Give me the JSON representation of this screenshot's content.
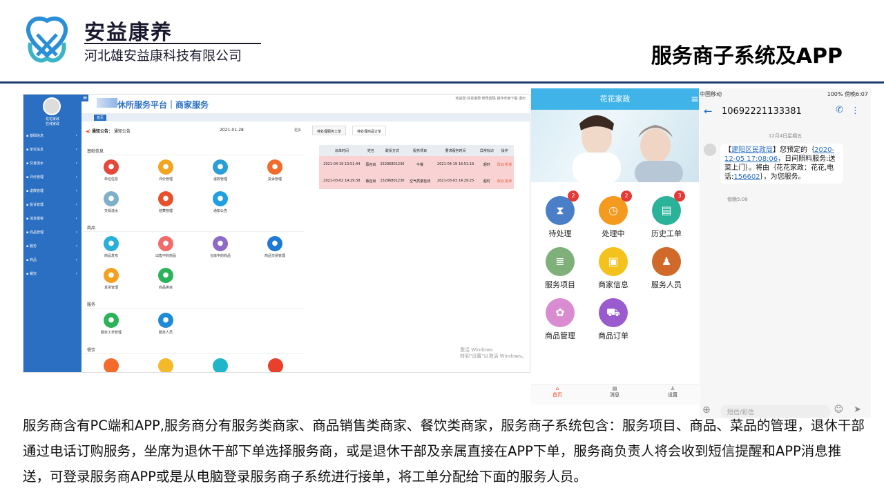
{
  "header": {
    "brand_name": "安益康养",
    "company_name": "河北雄安益康科技有限公司",
    "slide_title": "服务商子系统及APP",
    "accent_color": "#1d3c6e"
  },
  "pc": {
    "platform_title": "休所服务平台｜商家服务",
    "account_bar": "欢迎您:花花家政  修改密码  操作手册下载  退出",
    "user_name": "花花家政",
    "user_role": "在线家政",
    "sidebar": [
      "基础信息",
      "单位信息",
      "交易流水",
      "评价管理",
      "退款管理",
      "投诉管理",
      "消息模板",
      "商品管理",
      "服务",
      "商品",
      "餐饮"
    ],
    "tab_home": "首页",
    "notice_label": "通知公告：",
    "notice_text": "通知公告",
    "notice_date": "2021-01-28",
    "notice_more": "更多",
    "sections": [
      "基础信息",
      "商品",
      "服务",
      "餐饮"
    ],
    "basic_items": [
      "单位信息",
      "评价管理",
      "退款管理",
      "投诉管理",
      "交易流水",
      "结算管理",
      "通知公告"
    ],
    "goods_items": [
      "商品发布",
      "出售中的商品",
      "仓库中的商品",
      "商品交易管理",
      "发货管理",
      "商品类目"
    ],
    "service_items": [
      "服务工单管理",
      "服务人员"
    ],
    "order_tabs": [
      "待处理服务工单",
      "待处理商品订单"
    ],
    "order_headers": [
      "派单时间",
      "姓名",
      "联系方式",
      "服务项目",
      "要求服务时间",
      "异常标识",
      "操作"
    ],
    "orders": [
      {
        "time": "2021-04-19 13:51:44",
        "name": "蔡自启",
        "phone": "15296801230",
        "item": "午餐",
        "req": "2021-04-19 16:51:19",
        "flag": "超时",
        "op": "改派 拒单"
      },
      {
        "time": "2021-03-02 14:29:38",
        "name": "蔡自启",
        "phone": "15296801230",
        "item": "空气质量检测",
        "req": "2021-03-03 14:29:25",
        "flag": "超时",
        "op": "改派 拒单"
      }
    ],
    "watermark_1": "激活 Windows",
    "watermark_2": "转到\"设置\"以激活 Windows。"
  },
  "app": {
    "title": "花花家政",
    "tiles": [
      {
        "label": "待处理",
        "badge": "2",
        "color": "#4a7fc8",
        "icon": "hourglass-icon"
      },
      {
        "label": "处理中",
        "badge": "2",
        "color": "#f39a1f",
        "icon": "clock-icon"
      },
      {
        "label": "历史工单",
        "badge": "3",
        "color": "#2bb39a",
        "icon": "doc-icon"
      },
      {
        "label": "服务项目",
        "badge": "",
        "color": "#7fb07a",
        "icon": "list-icon"
      },
      {
        "label": "商家信息",
        "badge": "",
        "color": "#f4c21c",
        "icon": "card-icon"
      },
      {
        "label": "服务人员",
        "badge": "",
        "color": "#d06a2a",
        "icon": "person-icon"
      },
      {
        "label": "商品管理",
        "badge": "",
        "color": "#d98dd0",
        "icon": "gift-icon"
      },
      {
        "label": "商品订单",
        "badge": "",
        "color": "#9a5bcf",
        "icon": "cart-icon"
      }
    ],
    "tabbar": [
      "首页",
      "消息",
      "设置"
    ]
  },
  "sms": {
    "status_left": "中国移动",
    "status_right": "100%  傍晚6:07",
    "number": "10692221133381",
    "date": "12月4日星期五",
    "msg_pre": "【",
    "msg_org": "建阳区民政局",
    "msg_mid": "】您预定的｛",
    "msg_time": "2020-12-05 17:08:06",
    "msg_rest": "，日间照料服务:送菜上门｝。将由｛花花家政：花花,电话:",
    "msg_phone": "156602",
    "msg_end": "｝，为您服务。",
    "msg_time_label": "傍晚5:08",
    "input_placeholder": "短信/彩信"
  },
  "body_text": "服务商含有PC端和APP,服务商分有服务类商家、商品销售类商家、餐饮类商家，服务商子系统包含：服务项目、商品、菜品的管理，退休干部通过电话订购服务，坐席为退休干部下单选择服务商，或是退休干部及亲属直接在APP下单，服务商负责人将会收到短信提醒和APP消息推送，可登录服务商APP或是从电脑登录服务商子系统进行接单，将工单分配给下面的服务人员。"
}
